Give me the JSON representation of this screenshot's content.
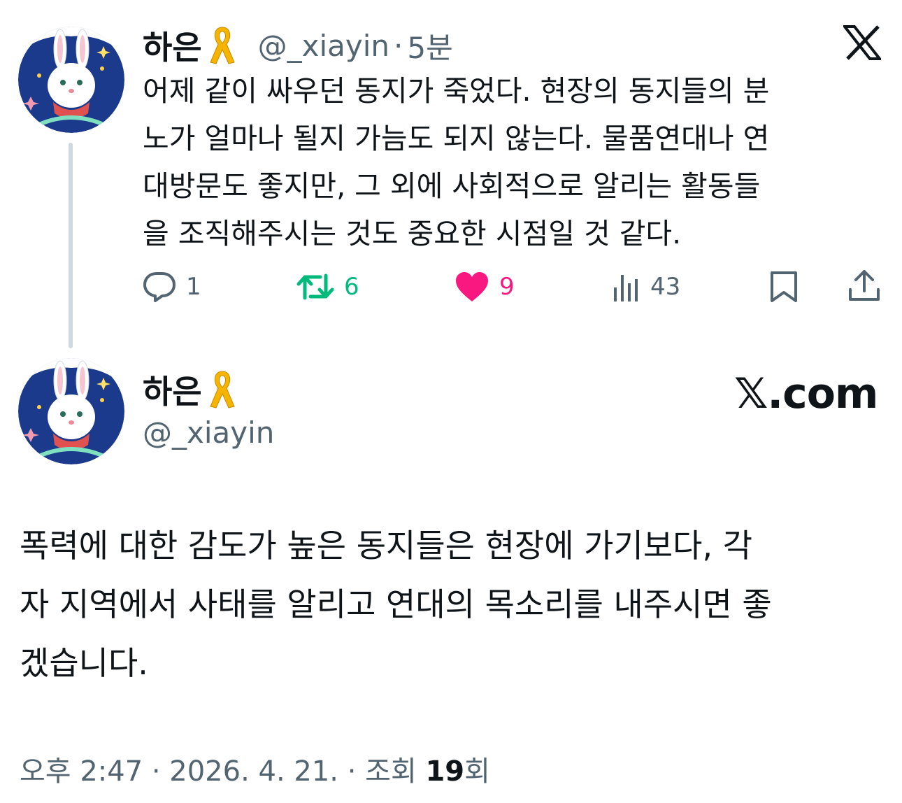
{
  "reply_tweet": {
    "display_name": "하은",
    "handle": "@_xiayin",
    "time_sep": "·",
    "time": "5분",
    "text": "어제 같이 싸우던 동지가 죽었다. 현장의 동지들의 분노가 얼마나 될지 가늠도 되지 않는다. 물품연대나 연대방문도 좋지만, 그 외에 사회적으로 알리는 활동들을 조직해주시는 것도 중요한 시점일 것 같다.",
    "lines": [
      "어제 같이 싸우던 동지가 죽었다. 현장의 동지들의 분",
      "노가 얼마나 될지 가늠도 되지 않는다. 물품연대나 연",
      "대방문도 좋지만, 그 외에 사회적으로 알리는 활동들",
      "을 조직해주시는 것도 중요한 시점일 것 같다."
    ],
    "replies": "1",
    "reposts": "6",
    "likes": "9",
    "views": "43"
  },
  "main_tweet": {
    "display_name": "하은",
    "handle": "@_xiayin",
    "brand": "𝕏.com",
    "lines": [
      "폭력에 대한 감도가 높은 동지들은 현장에 가기보다, 각",
      "자 지역에서 사태를 알리고 연대의 목소리를 내주시면 좋",
      "겠습니다."
    ],
    "timestamp": "오후 2:47 · 2026. 4. 21. · 조회 ",
    "view_count": "19",
    "view_suffix": "회"
  },
  "icons": {
    "x_logo": "x-logo-icon",
    "reply": "comment-bubble-icon",
    "repost": "repost-arrows-icon",
    "like": "heart-icon",
    "views": "bar-chart-icon",
    "bookmark": "bookmark-icon",
    "share": "share-upload-icon",
    "ribbon": "yellow-ribbon-icon"
  },
  "colors": {
    "repost_active": "#00ba7c",
    "like_active": "#f91880",
    "muted": "#536471",
    "text": "#0f1419",
    "ribbon": "#f4b400"
  }
}
